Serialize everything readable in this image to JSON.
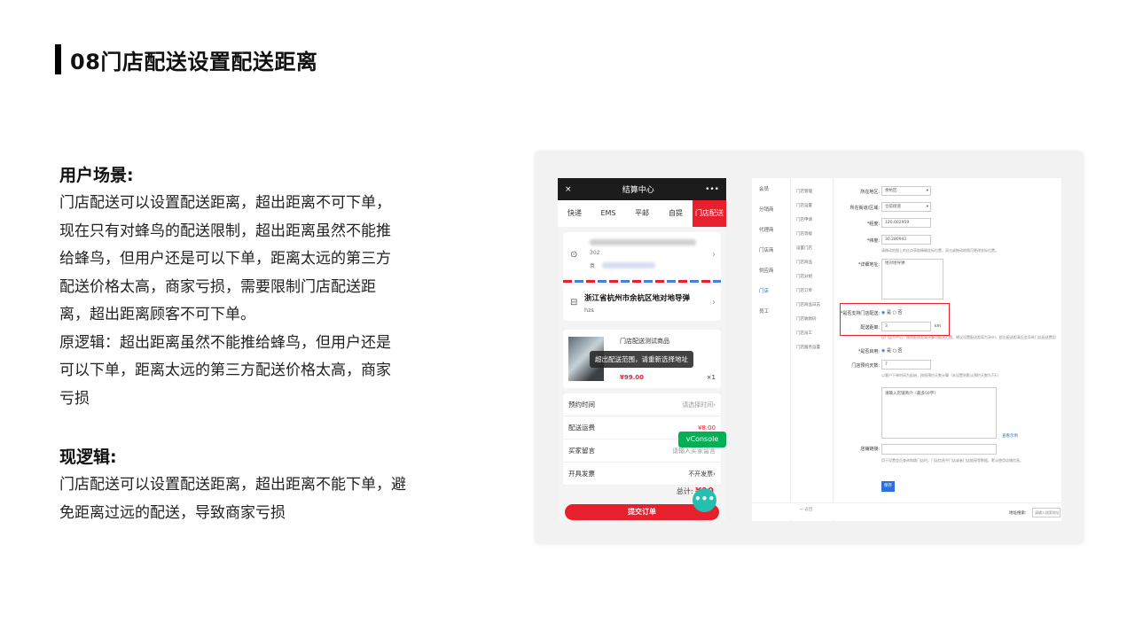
{
  "title": "08门店配送设置配送距离",
  "sections": {
    "scenario_heading": "用户场景:",
    "scenario_lines": [
      "门店配送可以设置配送距离，超出距离不可下单，",
      "现在只有对蜂鸟的配送限制，超出距离虽然不能推",
      "给蜂鸟，但用户还是可以下单，距离太远的第三方",
      "配送价格太高，商家亏损，需要限制门店配送距",
      "离，超出距离顾客不可下单。",
      "原逻辑：超出距离虽然不能推给蜂鸟，但用户还是",
      "可以下单，距离太远的第三方配送价格太高，商家",
      "亏损"
    ],
    "new_heading": "现逻辑:",
    "new_lines": [
      "门店配送可以设置配送距离，超出距离不能下单，避",
      "免距离过远的配送，导致商家亏损"
    ]
  },
  "phone": {
    "header_title": "结算中心",
    "close_icon": "×",
    "more_icon": "•••",
    "tabs": [
      "快递",
      "EMS",
      "平邮",
      "自提",
      "门店配送"
    ],
    "active_tab": 4,
    "address_blur_text": "302",
    "address_blur_tag": "袁",
    "store_address": "浙江省杭州市余杭区地对地导弹",
    "store_short": "hzs",
    "goods_name": "门店配送测试商品",
    "toast": "超出配送范围，请重新选择地址",
    "price": "¥99.00",
    "qty": "×1",
    "rows": [
      {
        "label": "预约时间",
        "value": "请选择时间›"
      },
      {
        "label": "配送运费",
        "value": "¥8.00"
      },
      {
        "label": "买家留言",
        "value": "请输入买家留言"
      },
      {
        "label": "开具发票",
        "value": "不开发票›"
      }
    ],
    "total_label": "总计:",
    "total_value": "¥10",
    "submit_label": "提交订单",
    "vconsole_label": "vConsole",
    "chat_icon": "•••"
  },
  "admin": {
    "nav1": [
      "会员",
      "分销商",
      "代理商",
      "门店商",
      "供应商",
      "门店",
      "员工"
    ],
    "nav1_active": 5,
    "nav2": [
      "门店管理",
      "门店设置",
      "门店申请",
      "门店等级",
      "设置门店",
      "门店商品",
      "门店分组",
      "门店订单",
      "门店商品日志",
      "门店收款码",
      "门店员工",
      "门店服务设置"
    ],
    "fields": {
      "region_label": "所在地区:",
      "region_value": "余杭区",
      "street_label": "所在街道/区域:",
      "street_value": "仓前街道",
      "lng_label": "*经度:",
      "lng_value": "120.002959",
      "lat_label": "*纬度:",
      "lat_value": "30.280941",
      "coord_hint": "请移动地图上的红点获取精确坐标位置，双击或拖动地图可更改坐标位置。",
      "address_label": "*详细地址:",
      "address_value": "地对地导弹",
      "support_label": "*是否支持门店配送:",
      "support_yes": "是",
      "support_no": "否",
      "distance_label": "配送距离:",
      "distance_value": "3",
      "distance_unit": "km",
      "distance_hint": "以门店为中心，按照配送距离计算可配送范围，建议设置配送距离为3km，超出配送距离后会导致门店配送费用",
      "enable_label": "*是否启用:",
      "enable_yes": "是",
      "enable_no": "否",
      "days_label": "门店预约天数:",
      "days_value": "7",
      "days_hint": "以客户下单时间为起始，按照预约天数计算（未设置则默认预约天数为7天）",
      "desc_placeholder": "请输入店铺简介（最多50字）",
      "preview_link": "查看示例",
      "link_label": "店铺链接:",
      "link_hint": "用于设置会员查询和跳门店时，门店信息中门店或者门店链接等数据，默认使用店铺信息。",
      "save_label": "保存",
      "back_label": "← 返回",
      "search_label": "地址搜索:",
      "search_placeholder": "请输入搜索地址"
    }
  },
  "colors": {
    "accent_red": "#e8202e",
    "admin_blue": "#2f6fdd",
    "vconsole_green": "#06ae56"
  }
}
